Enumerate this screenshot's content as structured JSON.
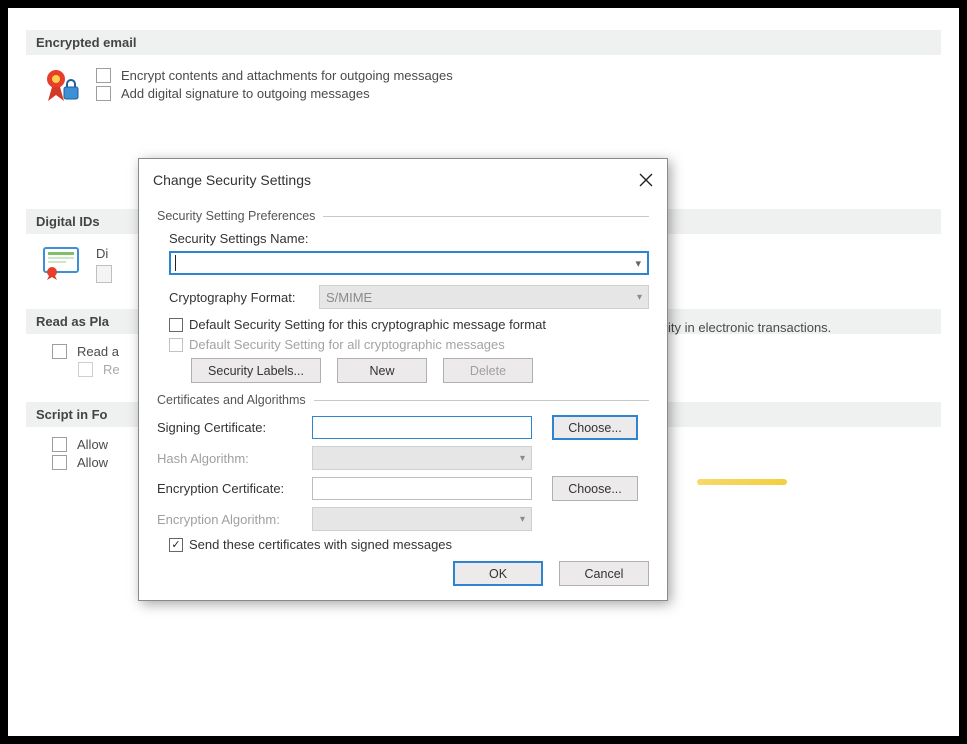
{
  "sections": {
    "encrypted": {
      "header": "Encrypted email",
      "opt_encrypt": "Encrypt contents and attachments for outgoing messages",
      "opt_sign": "Add digital signature to outgoing messages"
    },
    "digitalids": {
      "header": "Digital IDs",
      "row_prefix": "Di",
      "row_suffix": "ity in electronic transactions."
    },
    "readplain": {
      "header": "Read as Pla",
      "opt_readall": "Read a",
      "opt_readsub": "Re"
    },
    "script": {
      "header": "Script in Fo",
      "opt_allow1": "Allow",
      "opt_allow2": "Allow"
    }
  },
  "dialog": {
    "title": "Change Security Settings",
    "group_prefs": "Security Setting Preferences",
    "name_label": "Security Settings Name:",
    "name_value": "",
    "crypto_label": "Cryptography Format:",
    "crypto_value": "S/MIME",
    "chk_default_format": "Default Security Setting for this cryptographic message format",
    "chk_default_all": "Default Security Setting for all cryptographic messages",
    "btn_labels": "Security Labels...",
    "btn_new": "New",
    "btn_delete": "Delete",
    "group_certs": "Certificates and Algorithms",
    "signing_label": "Signing Certificate:",
    "hash_label": "Hash Algorithm:",
    "enc_cert_label": "Encryption Certificate:",
    "enc_algo_label": "Encryption Algorithm:",
    "choose": "Choose...",
    "chk_send": "Send these certificates with signed messages",
    "ok": "OK",
    "cancel": "Cancel"
  }
}
